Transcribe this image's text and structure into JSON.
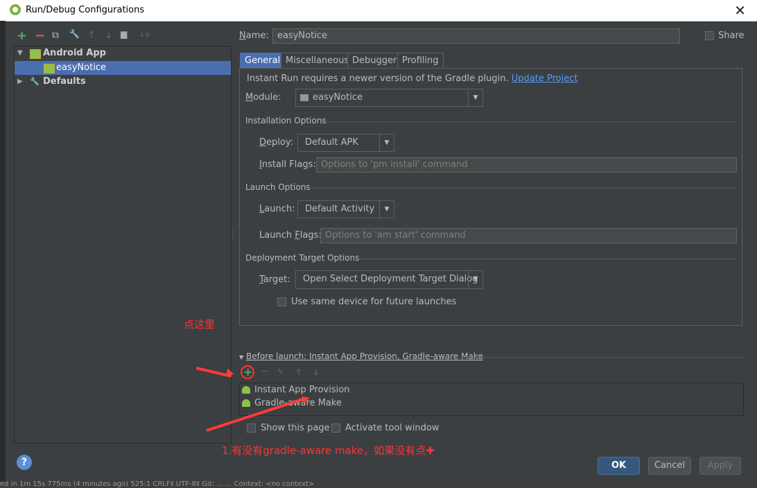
{
  "window": {
    "title": "Run/Debug Configurations",
    "close_glyph": "✕"
  },
  "toolbar": {
    "add": "+",
    "remove": "−",
    "copy": "⧉",
    "edit_defaults": "🔧",
    "up": "↑",
    "down": "↓",
    "folder": "▆",
    "sort": "↓a"
  },
  "tree": {
    "android_app": "Android App",
    "easy_notice": "easyNotice",
    "defaults": "Defaults"
  },
  "name_field": {
    "label_pre": "N",
    "label_post": "ame:",
    "value": "easyNotice"
  },
  "share": {
    "label": "Share",
    "checked": false
  },
  "tabs": [
    "General",
    "Miscellaneous",
    "Debugger",
    "Profiling"
  ],
  "general": {
    "instant_run_msg": "Instant Run requires a newer version of the Gradle plugin.",
    "update_link": "Update Project",
    "module_label_u": "M",
    "module_label_rest": "odule:",
    "module_value": "easyNotice",
    "installation_options": "Installation Options",
    "deploy_label_u": "D",
    "deploy_label_rest": "eploy:",
    "deploy_value": "Default APK",
    "install_flags_label_u": "I",
    "install_flags_label_rest": "nstall Flags:",
    "install_flags_placeholder": "Options to 'pm install' command",
    "launch_options": "Launch Options",
    "launch_label_u": "L",
    "launch_label_rest": "aunch:",
    "launch_value": "Default Activity",
    "launch_flags_label_pre": "Launch ",
    "launch_flags_label_u": "F",
    "launch_flags_label_rest": "lags:",
    "launch_flags_placeholder": "Options to 'am start' command",
    "deployment_target_options": "Deployment Target Options",
    "target_label_u": "T",
    "target_label_rest": "arget:",
    "target_value": "Open Select Deployment Target Dialog",
    "same_device_label": "Use same device for future launches"
  },
  "before_launch": {
    "header": "Before launch: Instant App Provision, Gradle-aware Make",
    "items": [
      "Instant App Provision",
      "Gradle-aware Make"
    ],
    "show_page": "Show this page",
    "activate_tool": "Activate tool window"
  },
  "annotations": {
    "click_here": "点这里",
    "note": "1.有没有gradle-aware make，如果没有点✚"
  },
  "buttons": {
    "ok": "OK",
    "cancel": "Cancel",
    "apply": "Apply",
    "help": "?"
  },
  "status_bar": "ed in 1m 15s 775ms (4 minutes ago)          525:1   CRLF‡   UTF-8‡   Git: ...   ...   Context: <no context>",
  "colors": {
    "accent": "#4b6eaf",
    "link": "#589df6",
    "annotation": "#ff3333",
    "android_green": "#8bc34a"
  }
}
